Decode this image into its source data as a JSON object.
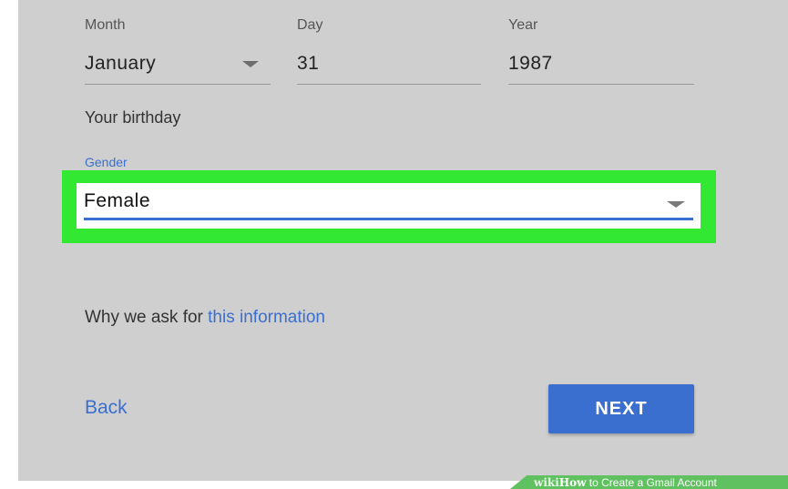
{
  "birthday": {
    "month_label": "Month",
    "month_value": "January",
    "day_label": "Day",
    "day_value": "31",
    "year_label": "Year",
    "year_value": "1987",
    "caption": "Your birthday"
  },
  "gender": {
    "label": "Gender",
    "value": "Female"
  },
  "info": {
    "prefix": "Why we ask for ",
    "link": "this information"
  },
  "actions": {
    "back": "Back",
    "next": "NEXT"
  },
  "watermark": {
    "logo": "wiki",
    "how": "How",
    "rest": " to Create a Gmail Account"
  },
  "colors": {
    "highlight": "#32e832",
    "accent": "#3a6fd0",
    "link": "#3b6fcf"
  }
}
